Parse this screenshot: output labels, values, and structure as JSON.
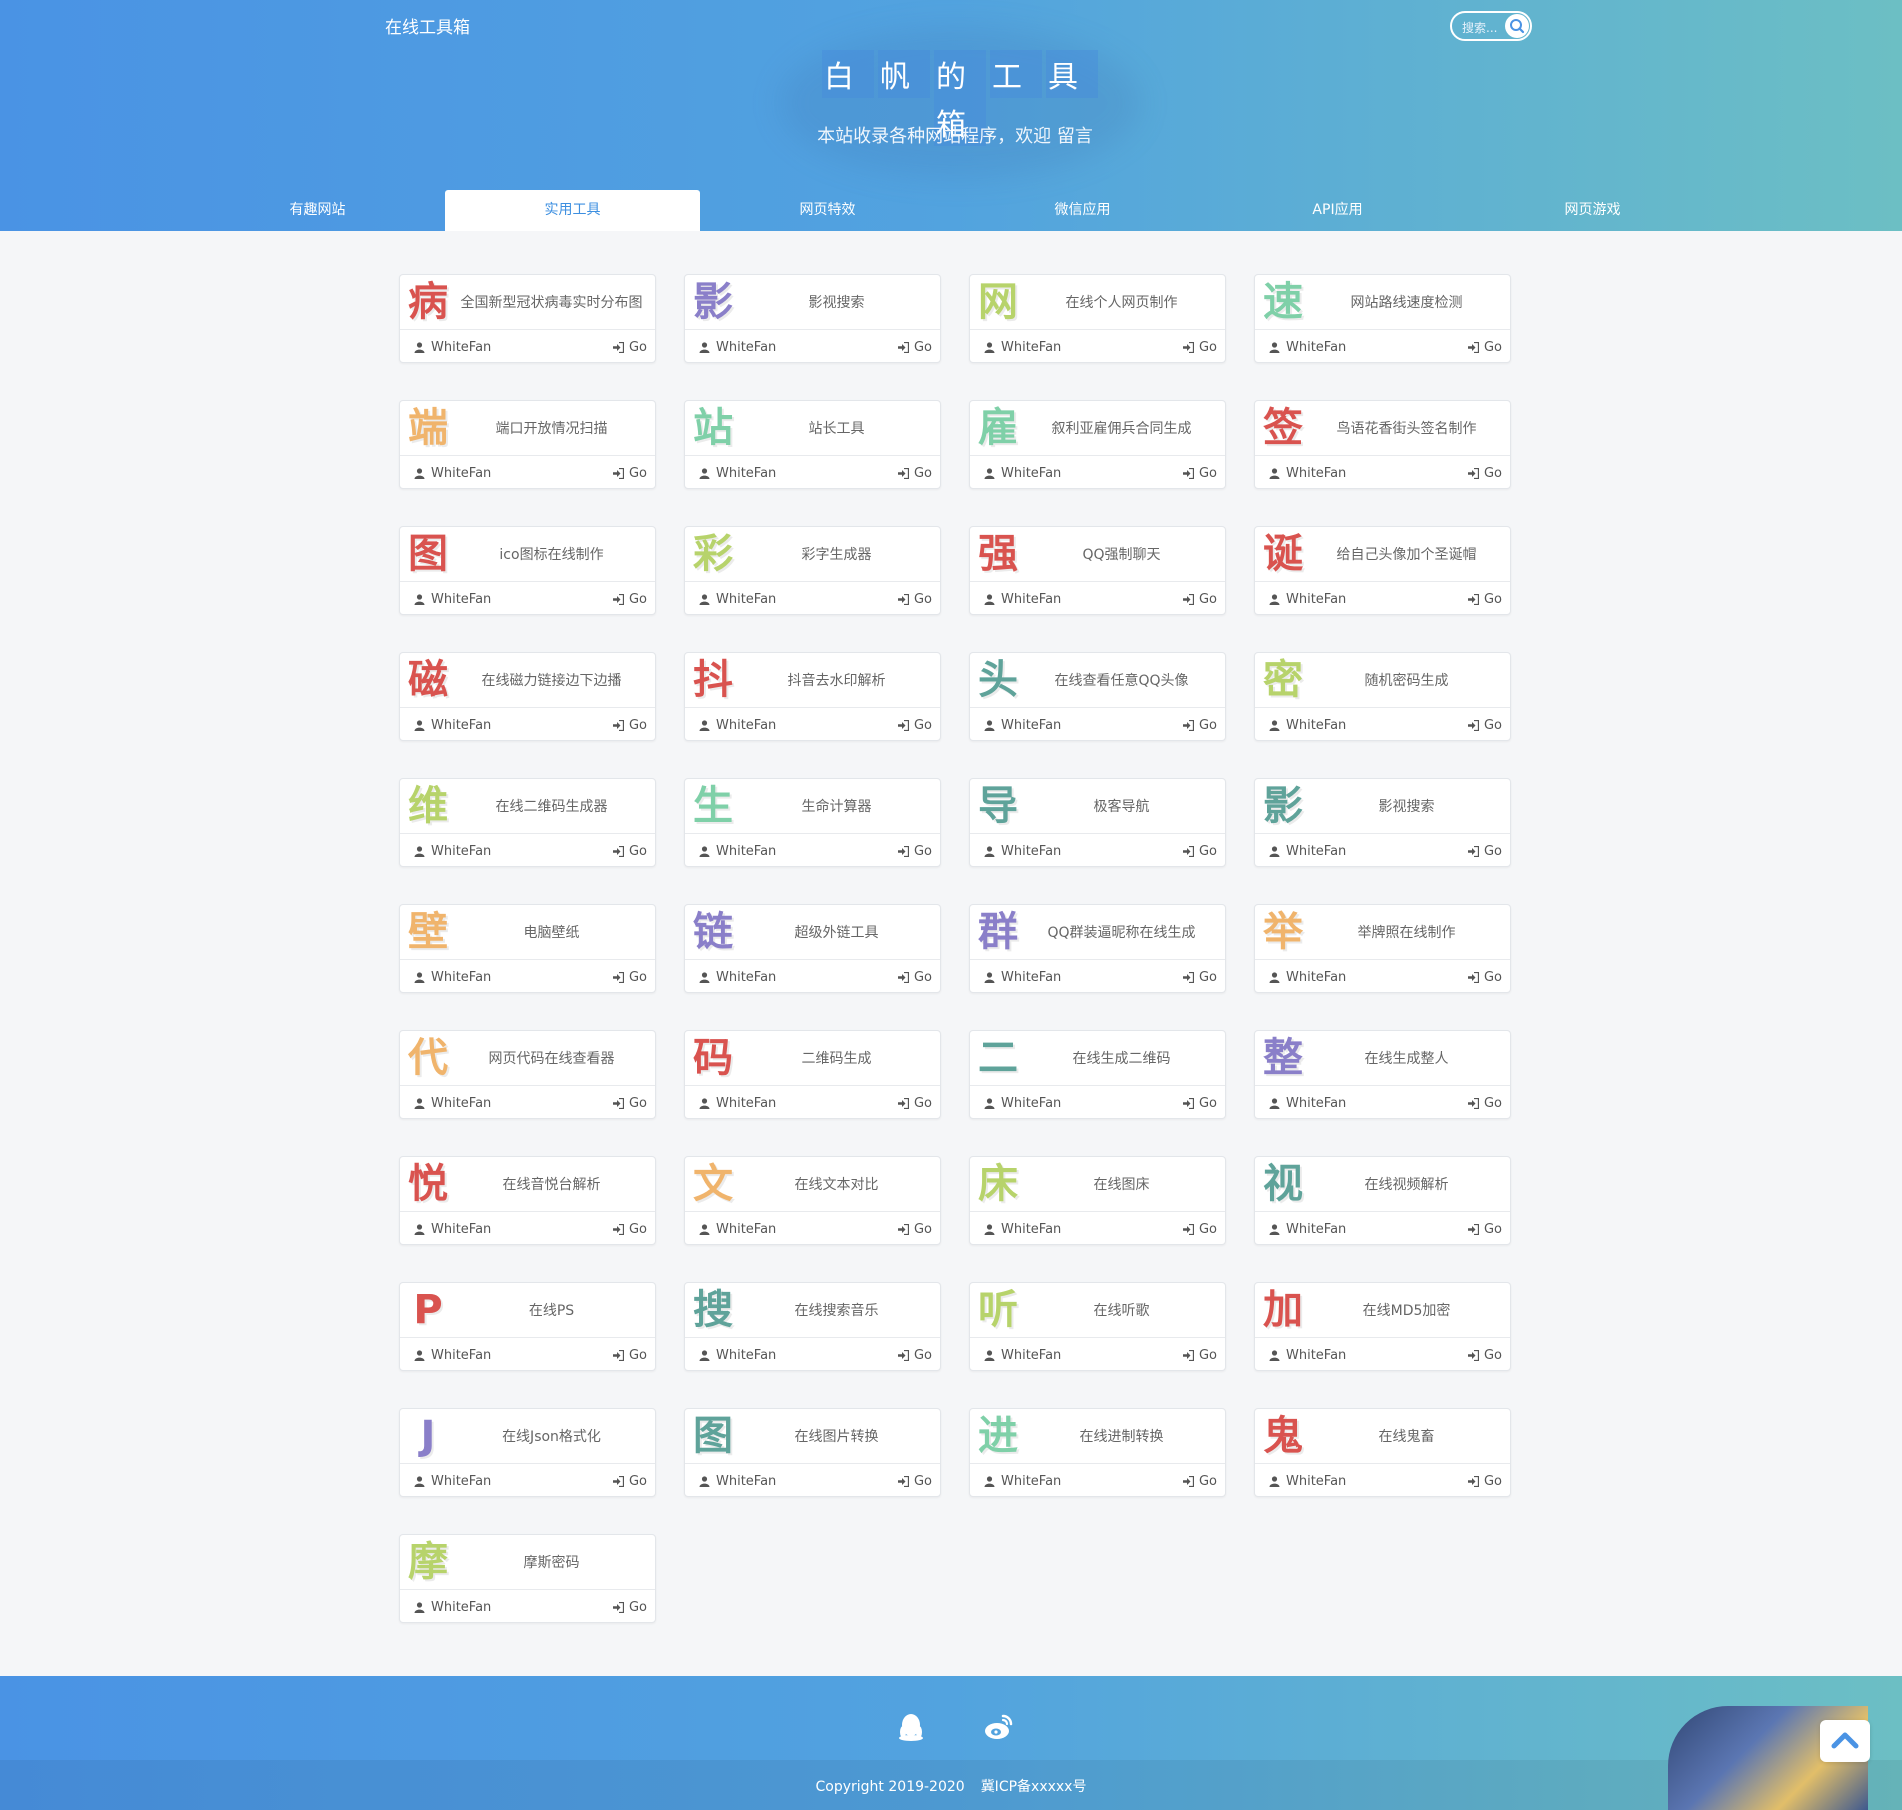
{
  "header": {
    "site_name": "在线工具箱",
    "search_placeholder": "搜索...",
    "hero_title": [
      "白",
      "帆",
      "的",
      "工",
      "具",
      "箱"
    ],
    "hero_subtitle": "本站收录各种网站程序，欢迎 留言"
  },
  "tabs": [
    {
      "label": "有趣网站",
      "active": false
    },
    {
      "label": "实用工具",
      "active": true
    },
    {
      "label": "网页特效",
      "active": false
    },
    {
      "label": "微信应用",
      "active": false
    },
    {
      "label": "API应用",
      "active": false
    },
    {
      "label": "网页游戏",
      "active": false
    }
  ],
  "card_author": "WhiteFan",
  "card_go": "Go",
  "cards": [
    {
      "char": "病",
      "title": "全国新型冠状病毒实时分布图",
      "color": "#d9534f"
    },
    {
      "char": "影",
      "title": "影视搜索",
      "color": "#8a7fc9"
    },
    {
      "char": "网",
      "title": "在线个人网页制作",
      "color": "#b7d36b"
    },
    {
      "char": "速",
      "title": "网站路线速度检测",
      "color": "#7fd0a8"
    },
    {
      "char": "端",
      "title": "端口开放情况扫描",
      "color": "#f0b46c"
    },
    {
      "char": "站",
      "title": "站长工具",
      "color": "#7fd0a8"
    },
    {
      "char": "雇",
      "title": "叙利亚雇佣兵合同生成",
      "color": "#7fd0a8"
    },
    {
      "char": "签",
      "title": "鸟语花香街头签名制作",
      "color": "#d9534f"
    },
    {
      "char": "图",
      "title": "ico图标在线制作",
      "color": "#d9534f"
    },
    {
      "char": "彩",
      "title": "彩字生成器",
      "color": "#b7d36b"
    },
    {
      "char": "强",
      "title": "QQ强制聊天",
      "color": "#d9534f"
    },
    {
      "char": "诞",
      "title": "给自己头像加个圣诞帽",
      "color": "#d9534f"
    },
    {
      "char": "磁",
      "title": "在线磁力链接边下边播",
      "color": "#d9534f"
    },
    {
      "char": "抖",
      "title": "抖音去水印解析",
      "color": "#d9534f"
    },
    {
      "char": "头",
      "title": "在线查看任意QQ头像",
      "color": "#5fa39a"
    },
    {
      "char": "密",
      "title": "随机密码生成",
      "color": "#b7d36b"
    },
    {
      "char": "维",
      "title": "在线二维码生成器",
      "color": "#b7d36b"
    },
    {
      "char": "生",
      "title": "生命计算器",
      "color": "#7fd0a8"
    },
    {
      "char": "导",
      "title": "极客导航",
      "color": "#5fa39a"
    },
    {
      "char": "影",
      "title": "影视搜索",
      "color": "#5fa39a"
    },
    {
      "char": "壁",
      "title": "电脑壁纸",
      "color": "#f0b46c"
    },
    {
      "char": "链",
      "title": "超级外链工具",
      "color": "#8a7fc9"
    },
    {
      "char": "群",
      "title": "QQ群装逼昵称在线生成",
      "color": "#8a7fc9"
    },
    {
      "char": "举",
      "title": "举牌照在线制作",
      "color": "#f0b46c"
    },
    {
      "char": "代",
      "title": "网页代码在线查看器",
      "color": "#f0b46c"
    },
    {
      "char": "码",
      "title": "二维码生成",
      "color": "#d9534f"
    },
    {
      "char": "二",
      "title": "在线生成二维码",
      "color": "#5fa39a"
    },
    {
      "char": "整",
      "title": "在线生成整人",
      "color": "#8a7fc9"
    },
    {
      "char": "悦",
      "title": "在线音悦台解析",
      "color": "#d9534f"
    },
    {
      "char": "文",
      "title": "在线文本对比",
      "color": "#f0b46c"
    },
    {
      "char": "床",
      "title": "在线图床",
      "color": "#b7d36b"
    },
    {
      "char": "视",
      "title": "在线视频解析",
      "color": "#5fa39a"
    },
    {
      "char": "P",
      "title": "在线PS",
      "color": "#d9534f"
    },
    {
      "char": "搜",
      "title": "在线搜索音乐",
      "color": "#5fa39a"
    },
    {
      "char": "听",
      "title": "在线听歌",
      "color": "#b7d36b"
    },
    {
      "char": "加",
      "title": "在线MD5加密",
      "color": "#d9534f"
    },
    {
      "char": "J",
      "title": "在线Json格式化",
      "color": "#8a7fc9"
    },
    {
      "char": "图",
      "title": "在线图片转换",
      "color": "#5fa39a"
    },
    {
      "char": "进",
      "title": "在线进制转换",
      "color": "#7fd0a8"
    },
    {
      "char": "鬼",
      "title": "在线鬼畜",
      "color": "#d9534f"
    },
    {
      "char": "摩",
      "title": "摩斯密码",
      "color": "#b7d36b"
    }
  ],
  "footer": {
    "copyright": "Copyright 2019-2020",
    "icp": "冀ICP备xxxxx号"
  },
  "colors": {
    "header_gradient_start": "#4a93e4",
    "header_gradient_end": "#6cbfc4",
    "active_tab_text": "#3d8fe0"
  },
  "icons": {
    "search": "search-icon",
    "user": "user-icon",
    "go": "sign-in-icon",
    "qq": "qq-icon",
    "weibo": "weibo-icon",
    "top": "back-to-top-icon"
  }
}
